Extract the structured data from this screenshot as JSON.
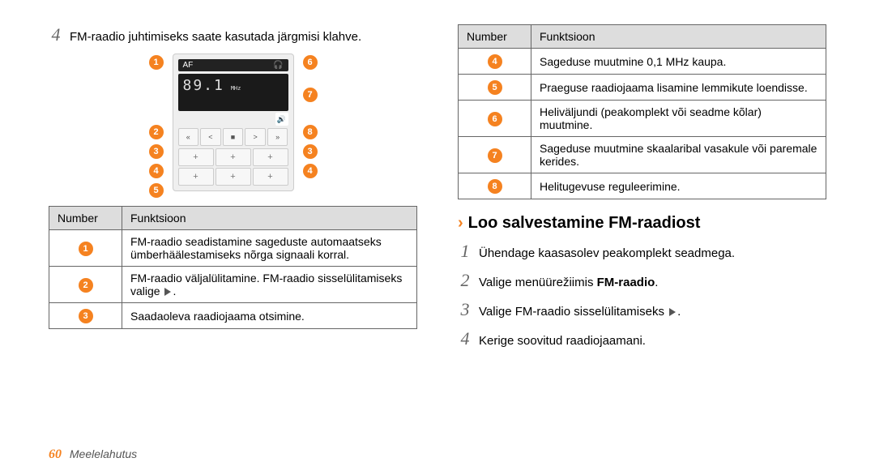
{
  "left": {
    "step4_num": "4",
    "step4_text": "FM-raadio juhtimiseks saate kasutada järgmisi klahve.",
    "radio_af": "AF",
    "radio_freq": "89.1",
    "radio_mhz": "MHz",
    "ctrl_prev_far": "«",
    "ctrl_prev": "<",
    "ctrl_stop": "■",
    "ctrl_next": ">",
    "ctrl_next_far": "»",
    "preset_plus": "+",
    "callouts_left": {
      "1": "1",
      "2": "2",
      "3": "3",
      "4": "4",
      "5": "5"
    },
    "callouts_right": {
      "6": "6",
      "7": "7",
      "8": "8",
      "3": "3",
      "4": "4"
    },
    "table_head_num": "Number",
    "table_head_fn": "Funktsioon",
    "rows": [
      {
        "n": "1",
        "fn": "FM-raadio seadistamine sageduste automaatseks ümberhäälestamiseks nõrga signaali korral."
      },
      {
        "n": "2",
        "fn_a": "FM-raadio väljalülitamine. FM-raadio sisselülitamiseks valige ",
        "fn_b": "."
      },
      {
        "n": "3",
        "fn": "Saadaoleva raadiojaama otsimine."
      }
    ]
  },
  "right": {
    "table_head_num": "Number",
    "table_head_fn": "Funktsioon",
    "rows": [
      {
        "n": "4",
        "fn": "Sageduse muutmine 0,1 MHz kaupa."
      },
      {
        "n": "5",
        "fn": "Praeguse raadiojaama lisamine lemmikute loendisse."
      },
      {
        "n": "6",
        "fn": "Heliväljundi (peakomplekt või seadme kõlar) muutmine."
      },
      {
        "n": "7",
        "fn": "Sageduse muutmine skaalaribal vasakule või paremale kerides."
      },
      {
        "n": "8",
        "fn": "Helitugevuse reguleerimine."
      }
    ],
    "section_title": "Loo salvestamine FM-raadiost",
    "steps": [
      {
        "num": "1",
        "text": "Ühendage kaasasolev peakomplekt seadmega."
      },
      {
        "num": "2",
        "text_a": "Valige menüürežiimis ",
        "bold": "FM-raadio",
        "text_b": "."
      },
      {
        "num": "3",
        "text_a": "Valige FM-raadio sisselülitamiseks ",
        "text_b": "."
      },
      {
        "num": "4",
        "text": "Kerige soovitud raadiojaamani."
      }
    ]
  },
  "footer": {
    "page": "60",
    "section": "Meelelahutus"
  }
}
